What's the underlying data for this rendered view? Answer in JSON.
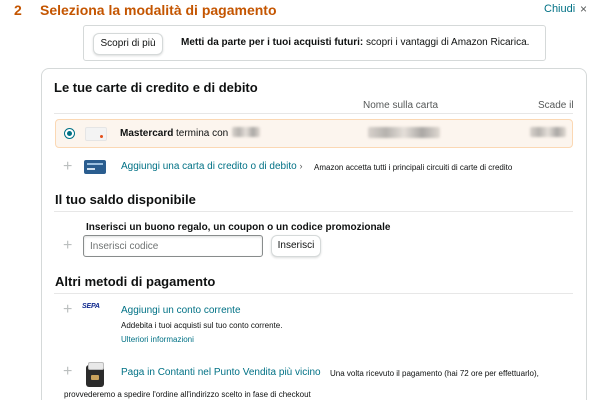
{
  "header": {
    "step_number": "2",
    "title": "Seleziona la modalità di pagamento",
    "close_label": "Chiudi",
    "close_icon": "×"
  },
  "promo": {
    "button_label": "Scopri di più",
    "bold_text": "Metti da parte per i tuoi acquisti futuri:",
    "text": " scopri i vantaggi di Amazon Ricarica."
  },
  "cards": {
    "title": "Le tue carte di credito e di debito",
    "col_name": "Nome sulla carta",
    "col_expiry": "Scade il",
    "selected_card": {
      "brand": "Mastercard",
      "suffix": "termina con",
      "icon": "mastercard-icon"
    },
    "add_link": "Aggiungi una carta di credito o di debito",
    "add_chevron": "›",
    "add_note": "Amazon accetta tutti i principali circuiti di carte di credito"
  },
  "balance": {
    "title": "Il tuo saldo disponibile",
    "voucher_label": "Inserisci un buono regalo, un coupon o un codice promozionale",
    "input_placeholder": "Inserisci codice",
    "apply_label": "Inserisci"
  },
  "other": {
    "title": "Altri metodi di pagamento",
    "bank": {
      "icon_text": "SEPA",
      "link": "Aggiungi un conto corrente",
      "desc": "Addebita i tuoi acquisti sul tuo conto corrente.",
      "more": "Ulteriori informazioni"
    },
    "cash": {
      "link": "Paga in Contanti nel Punto Vendita più vicino",
      "note": "Una volta ricevuto il pagamento (hai 72 ore per effettuarlo),",
      "note2": "provvederemo a spedire l'ordine all'indirizzo scelto in fase di checkout"
    }
  },
  "colors": {
    "accent": "#c45500",
    "link": "#007185",
    "selected_row_bg": "#fcf5ee"
  }
}
